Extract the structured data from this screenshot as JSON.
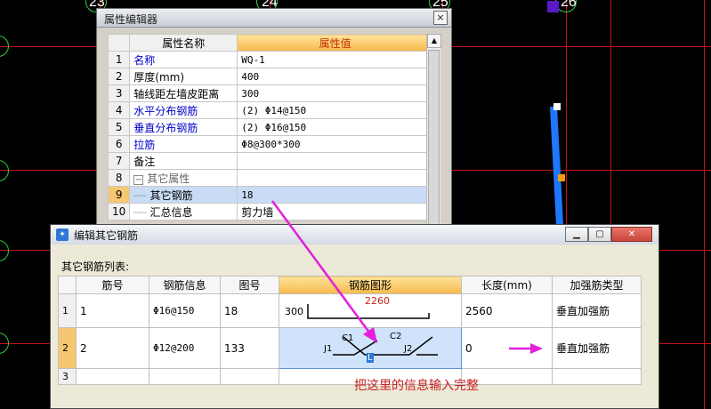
{
  "cad": {
    "axis_labels": [
      "23",
      "24",
      "25",
      "26"
    ]
  },
  "property_editor": {
    "title": "属性编辑器",
    "close_glyph": "×",
    "columns": [
      "属性名称",
      "属性值"
    ],
    "rows": [
      {
        "num": "1",
        "name": "名称",
        "value": "WQ-1",
        "name_blue": true
      },
      {
        "num": "2",
        "name": "厚度(mm)",
        "value": "400"
      },
      {
        "num": "3",
        "name": "轴线距左墙皮距离",
        "value": "300"
      },
      {
        "num": "4",
        "name": "水平分布钢筋",
        "value": "(2) Φ14@150",
        "name_blue": true
      },
      {
        "num": "5",
        "name": "垂直分布钢筋",
        "value": "(2) Φ16@150",
        "name_blue": true
      },
      {
        "num": "6",
        "name": "拉筋",
        "value": "Φ8@300*300",
        "name_blue": true
      },
      {
        "num": "7",
        "name": "备注",
        "value": ""
      },
      {
        "num": "8",
        "name": "其它属性",
        "value": ""
      },
      {
        "num": "9",
        "name": "其它钢筋",
        "value": "18"
      },
      {
        "num": "10",
        "name": "汇总信息",
        "value": "剪力墙"
      }
    ],
    "group_toggle": "−"
  },
  "dialog": {
    "title": "编辑其它钢筋",
    "list_label": "其它钢筋列表:",
    "columns": [
      "筋号",
      "钢筋信息",
      "图号",
      "钢筋图形",
      "长度(mm)",
      "加强筋类型"
    ],
    "rows": [
      {
        "rn": "1",
        "bar_no": "1",
        "info": "Φ16@150",
        "fig": "18",
        "length": "2560",
        "type": "垂直加强筋"
      },
      {
        "rn": "2",
        "bar_no": "2",
        "info": "Φ12@200",
        "fig": "133",
        "length": "0",
        "type": "垂直加强筋"
      },
      {
        "rn": "3",
        "bar_no": "",
        "info": "",
        "fig": "",
        "length": "",
        "type": ""
      }
    ],
    "shape1": {
      "left": "300",
      "dim": "2260"
    },
    "shape2": {
      "j1": "J1",
      "j2": "J2",
      "c1": "C1",
      "c2": "C2",
      "mid": "L"
    },
    "annotation": "把这里的信息输入完整"
  },
  "colors": {
    "cad_line": "#c0141c",
    "wall": "#1e78ff",
    "highlight_header": "#f5b94a",
    "selection": "#c9dcf5",
    "arrow": "#e31fdc"
  }
}
